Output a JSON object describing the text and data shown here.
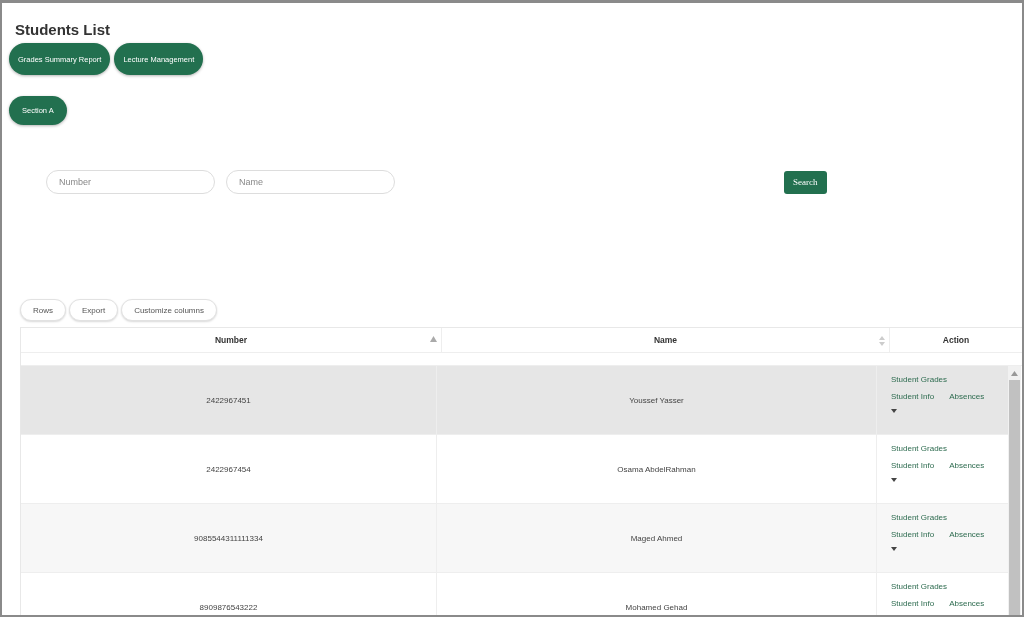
{
  "title": "Students List",
  "top_buttons": [
    "Grades Summary Report",
    "Lecture Management"
  ],
  "section_button": "Section A",
  "search": {
    "fields": [
      {
        "placeholder": "Number"
      },
      {
        "placeholder": "Name"
      }
    ],
    "button": "Search"
  },
  "table_tools": [
    "Rows",
    "Export",
    "Customize columns"
  ],
  "table": {
    "columns": [
      {
        "label": "Number",
        "kind": "sorted"
      },
      {
        "label": "Name",
        "kind": "sortable"
      },
      {
        "label": "Action",
        "kind": "plain"
      }
    ],
    "rows": [
      {
        "number": "2422967451",
        "name": "Youssef Yasser",
        "selected": true,
        "actions": [
          "Student Grades",
          "Student Info",
          "Absences"
        ]
      },
      {
        "number": "2422967454",
        "name": "Osama AbdelRahman",
        "selected": false,
        "actions": [
          "Student Grades",
          "Student Info",
          "Absences"
        ]
      },
      {
        "number": "9085544311111334",
        "name": "Maged Ahmed",
        "selected": false,
        "actions": [
          "Student Grades",
          "Student Info",
          "Absences"
        ]
      },
      {
        "number": "8909876543222",
        "name": "Mohamed Gehad",
        "selected": false,
        "actions": [
          "Student Grades",
          "Student Info",
          "Absences"
        ]
      }
    ]
  }
}
